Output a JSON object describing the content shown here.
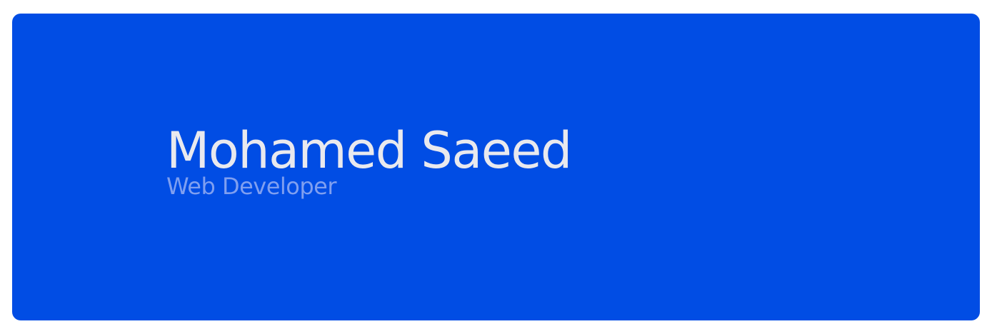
{
  "profile": {
    "name": "Mohamed Saeed",
    "role": "Web Developer"
  },
  "colors": {
    "page_background": "#ffffff",
    "card_background": "#014de4",
    "name_text": "#e9e9ee",
    "role_text": "#7f9ff0"
  }
}
